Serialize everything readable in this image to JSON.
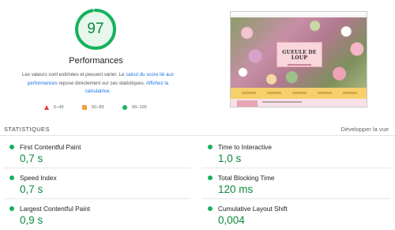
{
  "score": {
    "value": "97",
    "fraction": 0.97,
    "color": "#0d8a3c",
    "ring_color": "#17b15e",
    "track_color": "#e5f6ea",
    "title": "Performances"
  },
  "description": {
    "part1": "Les valeurs sont estimées et peuvent varier. Le ",
    "link1": "calcul du score lié aux performances",
    "part2": " repose directement sur ces statistiques. ",
    "link2": "Affichez la calculatrice",
    "part3": "."
  },
  "legend": [
    {
      "range": "0–49",
      "shape": "triangle",
      "color": "#e53935"
    },
    {
      "range": "50–89",
      "shape": "square",
      "color": "#f29e46"
    },
    {
      "range": "90–100",
      "shape": "circle",
      "color": "#17b15e"
    }
  ],
  "preview": {
    "brand": "GUEULE DE LOUP"
  },
  "statistics": {
    "header": "STATISTIQUES",
    "expand": "Développer la vue",
    "metrics": [
      {
        "name": "First Contentful Paint",
        "value": "0,7 s"
      },
      {
        "name": "Time to Interactive",
        "value": "1,0 s"
      },
      {
        "name": "Speed Index",
        "value": "0,7 s"
      },
      {
        "name": "Total Blocking Time",
        "value": "120 ms"
      },
      {
        "name": "Largest Contentful Paint",
        "value": "0,9 s"
      },
      {
        "name": "Cumulative Layout Shift",
        "value": "0,004"
      }
    ]
  }
}
